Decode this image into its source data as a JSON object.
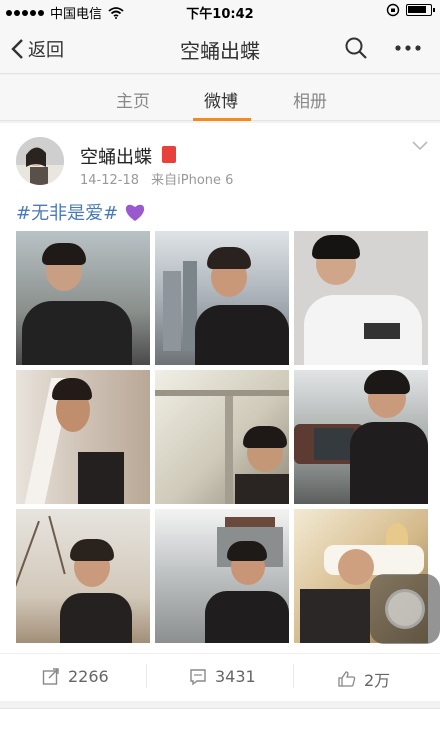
{
  "status_bar": {
    "carrier": "中国电信",
    "time": "下午10:42"
  },
  "nav": {
    "back_label": "返回",
    "title": "空蛹出蝶"
  },
  "tabs": [
    {
      "label": "主页",
      "active": false
    },
    {
      "label": "微博",
      "active": true
    },
    {
      "label": "相册",
      "active": false
    }
  ],
  "post": {
    "username": "空蛹出蝶",
    "timestamp": "14-12-18",
    "source": "来自iPhone 6",
    "text": "#无非是爱#",
    "emoji": "purple-heart",
    "photo_count": 9,
    "repost_count": "2266",
    "comment_count": "3431",
    "like_count": "2万"
  },
  "colors": {
    "accent_underline": "#f28a1d",
    "hashtag": "#4a7ab8",
    "badge": "#e8403a",
    "heart": "#9b59d0"
  }
}
